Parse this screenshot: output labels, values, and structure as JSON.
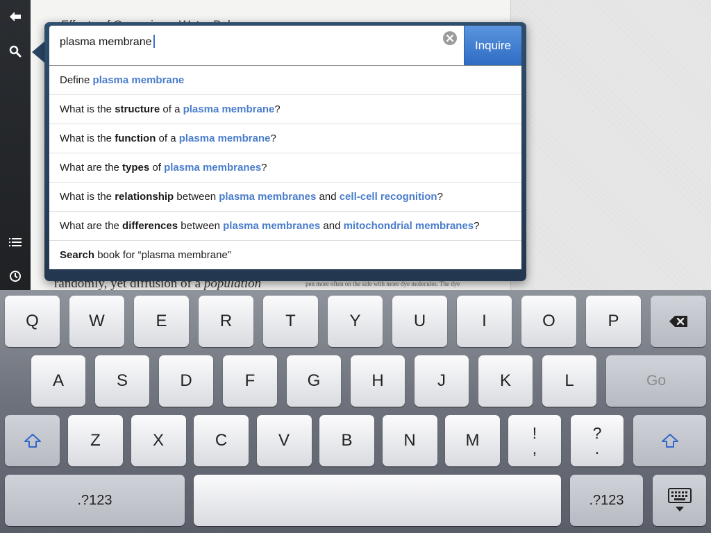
{
  "book": {
    "heading": "Effects of Osmosis on Water Balance",
    "body_left_prefix": "randomly, yet diffusion of a ",
    "body_left_italic": "population",
    "body_right": "pen more often on the side with more dye molecules. The dye"
  },
  "sidebar": {
    "items": [
      {
        "name": "back-arrow-icon"
      },
      {
        "name": "search-icon"
      },
      {
        "name": "list-icon"
      },
      {
        "name": "clock-icon"
      }
    ]
  },
  "search": {
    "query": "plasma membrane",
    "button_label": "Inquire"
  },
  "suggestions": [
    [
      {
        "t": "Define "
      },
      {
        "t": "plasma membrane",
        "s": "hl"
      }
    ],
    [
      {
        "t": "What is the "
      },
      {
        "t": "structure",
        "s": "b"
      },
      {
        "t": " of a "
      },
      {
        "t": "plasma membrane",
        "s": "hl"
      },
      {
        "t": "?"
      }
    ],
    [
      {
        "t": "What is the "
      },
      {
        "t": "function",
        "s": "b"
      },
      {
        "t": " of a "
      },
      {
        "t": "plasma membrane",
        "s": "hl"
      },
      {
        "t": "?"
      }
    ],
    [
      {
        "t": "What are the "
      },
      {
        "t": "types",
        "s": "b"
      },
      {
        "t": " of "
      },
      {
        "t": "plasma membranes",
        "s": "hl"
      },
      {
        "t": "?"
      }
    ],
    [
      {
        "t": "What is the "
      },
      {
        "t": "relationship",
        "s": "b"
      },
      {
        "t": " between "
      },
      {
        "t": "plasma membranes",
        "s": "hl"
      },
      {
        "t": " and "
      },
      {
        "t": "cell-cell recognition",
        "s": "hl"
      },
      {
        "t": "?"
      }
    ],
    [
      {
        "t": "What are the "
      },
      {
        "t": "differences",
        "s": "b"
      },
      {
        "t": " between "
      },
      {
        "t": "plasma membranes",
        "s": "hl"
      },
      {
        "t": " and "
      },
      {
        "t": "mitochondrial membranes",
        "s": "hl"
      },
      {
        "t": "?"
      }
    ],
    [
      {
        "t": "Search",
        "s": "b"
      },
      {
        "t": " book for “plasma membrane”"
      }
    ]
  ],
  "keyboard": {
    "row1": [
      "Q",
      "W",
      "E",
      "R",
      "T",
      "Y",
      "U",
      "I",
      "O",
      "P"
    ],
    "row2": [
      "A",
      "S",
      "D",
      "F",
      "G",
      "H",
      "J",
      "K",
      "L"
    ],
    "row3": [
      "Z",
      "X",
      "C",
      "V",
      "B",
      "N",
      "M"
    ],
    "go_label": "Go",
    "num_label": ".?123",
    "punct1": [
      "!",
      ","
    ],
    "punct2": [
      "?",
      "."
    ],
    "icons": {
      "backspace": "backspace-icon",
      "shift": "shift-icon",
      "dismiss": "keyboard-dismiss-icon"
    }
  },
  "colors": {
    "accent": "#3b6fd6",
    "highlight": "#4a7dcb",
    "popover": "#2b4766",
    "sidebar": "#25282c"
  }
}
